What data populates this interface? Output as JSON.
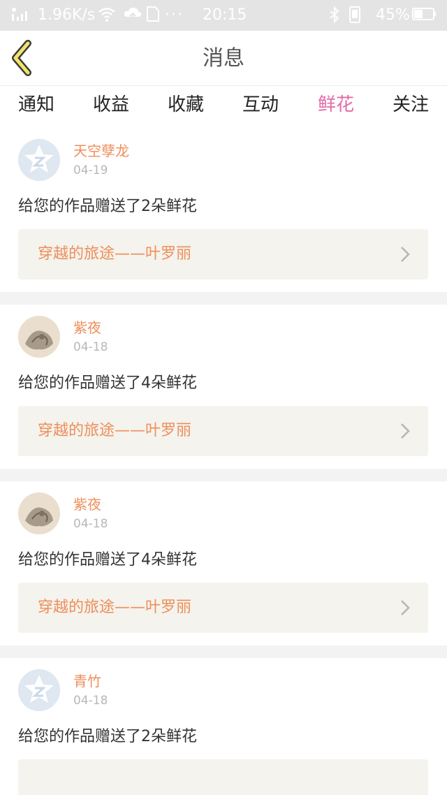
{
  "status_bar": {
    "network_speed": "1.96K/s",
    "dots": "···",
    "time": "20:15",
    "battery_percent": "45%"
  },
  "nav": {
    "title": "消息"
  },
  "tabs": [
    {
      "label": "通知",
      "active": false
    },
    {
      "label": "收益",
      "active": false
    },
    {
      "label": "收藏",
      "active": false
    },
    {
      "label": "互动",
      "active": false
    },
    {
      "label": "鲜花",
      "active": true
    },
    {
      "label": "关注",
      "active": false
    }
  ],
  "messages": [
    {
      "sender": "天空孽龙",
      "date": "04-19",
      "avatar": "default-qq-avatar",
      "text": "给您的作品赠送了2朵鲜花",
      "work_title": "穿越的旅途——叶罗丽"
    },
    {
      "sender": "紫夜",
      "date": "04-18",
      "avatar": "photo-avatar",
      "text": "给您的作品赠送了4朵鲜花",
      "work_title": "穿越的旅途——叶罗丽"
    },
    {
      "sender": "紫夜",
      "date": "04-18",
      "avatar": "photo-avatar",
      "text": "给您的作品赠送了4朵鲜花",
      "work_title": "穿越的旅途——叶罗丽"
    },
    {
      "sender": "青竹",
      "date": "04-18",
      "avatar": "default-qq-avatar",
      "text": "给您的作品赠送了2朵鲜花",
      "work_title": ""
    }
  ],
  "colors": {
    "accent_pink": "#e36aa8",
    "name_orange": "#ee8e5a",
    "link_background": "#f4f3ed",
    "back_arrow_yellow": "#f2e36a"
  }
}
